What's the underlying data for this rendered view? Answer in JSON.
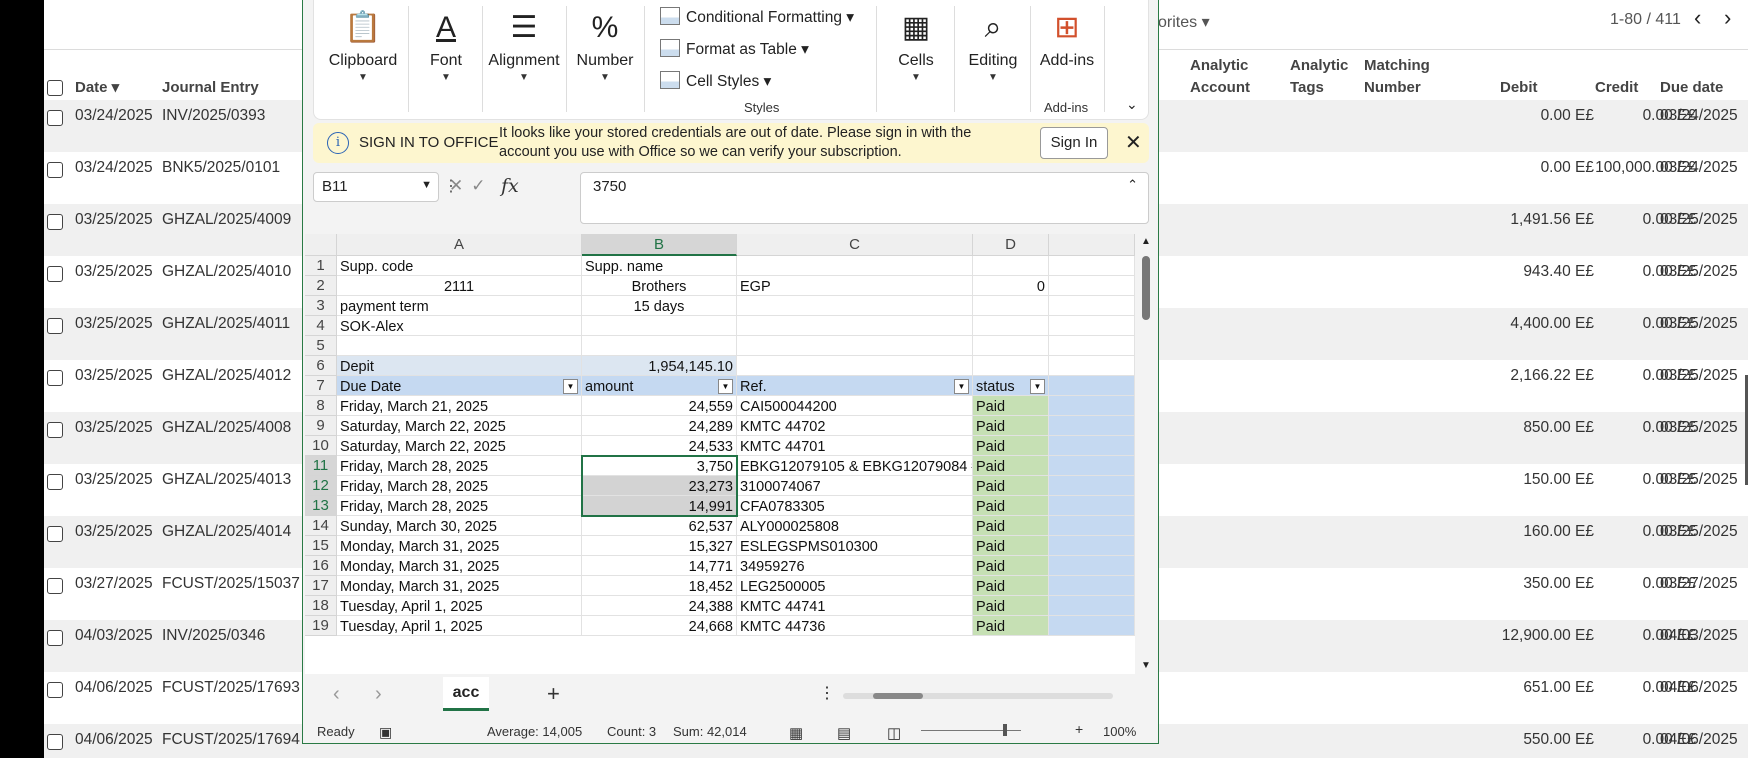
{
  "background": {
    "favorites_label": "orites",
    "pager": "1-80 / 411",
    "headers": {
      "date": "Date",
      "journal": "Journal Entry",
      "analytic_account": "Analytic Account",
      "analytic_tags": "Analytic Tags",
      "matching": "Matching Number",
      "debit": "Debit",
      "credit": "Credit",
      "due": "Due date"
    },
    "rows": [
      {
        "date": "03/24/2025",
        "je": "INV/2025/0393",
        "debit": "0.00 E£",
        "credit": "0.00 E£",
        "due": "03/24/2025"
      },
      {
        "date": "03/24/2025",
        "je": "BNK5/2025/0101",
        "debit": "0.00 E£",
        "credit": "100,000.00 E£",
        "due": "03/24/2025"
      },
      {
        "date": "03/25/2025",
        "je": "GHZAL/2025/4009",
        "debit": "1,491.56 E£",
        "credit": "0.00 E£",
        "due": "03/25/2025"
      },
      {
        "date": "03/25/2025",
        "je": "GHZAL/2025/4010",
        "debit": "943.40 E£",
        "credit": "0.00 E£",
        "due": "03/25/2025"
      },
      {
        "date": "03/25/2025",
        "je": "GHZAL/2025/4011",
        "debit": "4,400.00 E£",
        "credit": "0.00 E£",
        "due": "03/25/2025"
      },
      {
        "date": "03/25/2025",
        "je": "GHZAL/2025/4012",
        "debit": "2,166.22 E£",
        "credit": "0.00 E£",
        "due": "03/25/2025"
      },
      {
        "date": "03/25/2025",
        "je": "GHZAL/2025/4008",
        "debit": "850.00 E£",
        "credit": "0.00 E£",
        "due": "03/25/2025"
      },
      {
        "date": "03/25/2025",
        "je": "GHZAL/2025/4013",
        "debit": "150.00 E£",
        "credit": "0.00 E£",
        "due": "03/25/2025"
      },
      {
        "date": "03/25/2025",
        "je": "GHZAL/2025/4014",
        "debit": "160.00 E£",
        "credit": "0.00 E£",
        "due": "03/25/2025"
      },
      {
        "date": "03/27/2025",
        "je": "FCUST/2025/15037",
        "debit": "350.00 E£",
        "credit": "0.00 E£",
        "due": "03/27/2025"
      },
      {
        "date": "04/03/2025",
        "je": "INV/2025/0346",
        "debit": "12,900.00 E£",
        "credit": "0.00 E£",
        "due": "04/03/2025"
      },
      {
        "date": "04/06/2025",
        "je": "FCUST/2025/17693",
        "debit": "651.00 E£",
        "credit": "0.00 E£",
        "due": "04/06/2025"
      },
      {
        "date": "04/06/2025",
        "je": "FCUST/2025/17694",
        "debit": "550.00 E£",
        "credit": "0.00 E£",
        "due": "04/06/2025"
      }
    ]
  },
  "excel": {
    "ribbon": {
      "clipboard": "Clipboard",
      "font": "Font",
      "alignment": "Alignment",
      "number": "Number",
      "cond_format": "Conditional Formatting",
      "format_table": "Format as Table",
      "cell_styles": "Cell Styles",
      "styles": "Styles",
      "cells": "Cells",
      "editing": "Editing",
      "addins": "Add-ins",
      "addins_group": "Add-ins"
    },
    "banner": {
      "title": "SIGN IN TO OFFICE",
      "message": "It looks like your stored credentials are out of date. Please sign in with the account you use with Office so we can verify your subscription.",
      "signin": "Sign In"
    },
    "namebox": "B11",
    "formula": "3750",
    "columns": [
      "A",
      "B",
      "C",
      "D"
    ],
    "sheet_rows": [
      {
        "n": "1",
        "a": "Supp. code",
        "b": "Supp. name",
        "c": "",
        "d": ""
      },
      {
        "n": "2",
        "a": "2111",
        "b": "Brothers",
        "c": "EGP",
        "d": "0"
      },
      {
        "n": "3",
        "a": "payment term",
        "b": "15 days",
        "c": "",
        "d": ""
      },
      {
        "n": "4",
        "a": "SOK-Alex",
        "b": "",
        "c": "",
        "d": ""
      },
      {
        "n": "5",
        "a": "",
        "b": "",
        "c": "",
        "d": ""
      },
      {
        "n": "6",
        "a": "Depit",
        "b": "1,954,145.10",
        "c": "",
        "d": ""
      },
      {
        "n": "7",
        "a": "Due Date",
        "b": "amount",
        "c": "Ref.",
        "d": "status"
      },
      {
        "n": "8",
        "a": "Friday, March 21, 2025",
        "b": "24,559",
        "c": "CAI500044200",
        "d": "Paid"
      },
      {
        "n": "9",
        "a": "Saturday, March 22, 2025",
        "b": "24,289",
        "c": "KMTC 44702",
        "d": "Paid"
      },
      {
        "n": "10",
        "a": "Saturday, March 22, 2025",
        "b": "24,533",
        "c": "KMTC 44701",
        "d": "Paid"
      },
      {
        "n": "11",
        "a": "Friday, March 28, 2025",
        "b": "3,750",
        "c": "EBKG12079105 & EBKG12079084 #",
        "d": "Paid"
      },
      {
        "n": "12",
        "a": "Friday, March 28, 2025",
        "b": "23,273",
        "c": "3100074067",
        "d": "Paid"
      },
      {
        "n": "13",
        "a": "Friday, March 28, 2025",
        "b": "14,991",
        "c": "CFA0783305",
        "d": "Paid"
      },
      {
        "n": "14",
        "a": "Sunday, March 30, 2025",
        "b": "62,537",
        "c": "ALY000025808",
        "d": "Paid"
      },
      {
        "n": "15",
        "a": "Monday, March 31, 2025",
        "b": "15,327",
        "c": "ESLEGSPMS010300",
        "d": "Paid"
      },
      {
        "n": "16",
        "a": "Monday, March 31, 2025",
        "b": "14,771",
        "c": "34959276",
        "d": "Paid"
      },
      {
        "n": "17",
        "a": "Monday, March 31, 2025",
        "b": "18,452",
        "c": "LEG2500005",
        "d": "Paid"
      },
      {
        "n": "18",
        "a": "Tuesday, April 1, 2025",
        "b": "24,388",
        "c": "KMTC 44741",
        "d": "Paid"
      },
      {
        "n": "19",
        "a": "Tuesday, April 1, 2025",
        "b": "24,668",
        "c": "KMTC 44736",
        "d": "Paid"
      }
    ],
    "sheet_tab": "acc",
    "status": {
      "ready": "Ready",
      "average": "Average:  14,005",
      "count": "Count: 3",
      "sum": "Sum:  42,014",
      "zoom": "100%"
    }
  }
}
